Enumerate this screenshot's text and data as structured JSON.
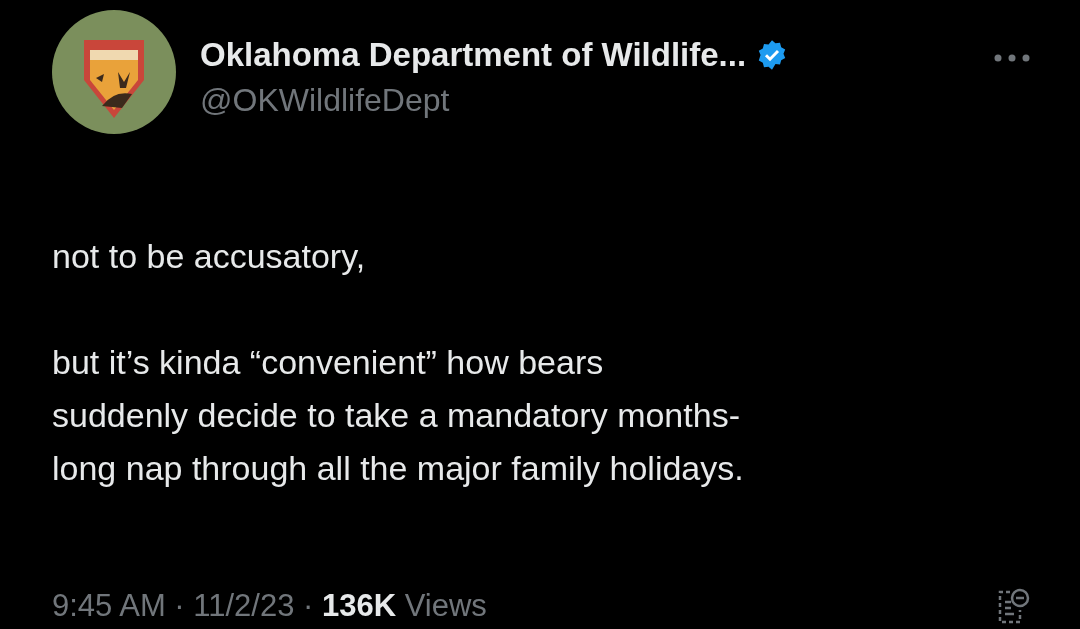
{
  "author": {
    "name": "Oklahoma Department of Wildlife...",
    "verified": true,
    "handle": "@OKWildlifeDept"
  },
  "paragraphs": [
    "not to be accusatory,",
    "but it’s kinda “convenient” how bears\nsuddenly decide to take a mandatory months-\nlong nap through all the major family holidays."
  ],
  "meta": "9:45 AM · 11/2/23 · **136K** Views"
}
